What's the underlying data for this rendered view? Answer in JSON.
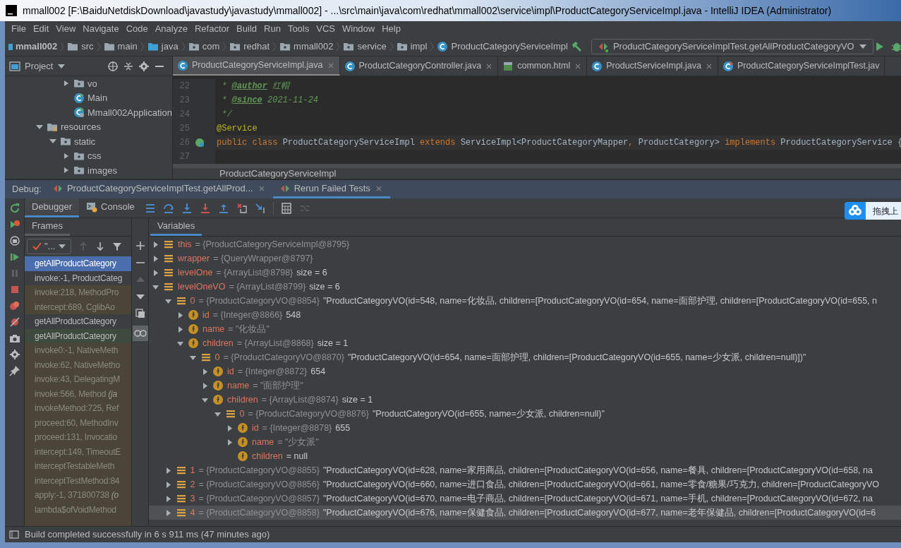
{
  "window": {
    "title": "mmall002 [F:\\BaiduNetdiskDownload\\javastudy\\javastudy\\mmall002] - ...\\src\\main\\java\\com\\redhat\\mmall002\\service\\impl\\ProductCategoryServiceImpl.java - IntelliJ IDEA (Administrator)"
  },
  "menu": [
    "File",
    "Edit",
    "View",
    "Navigate",
    "Code",
    "Analyze",
    "Refactor",
    "Build",
    "Run",
    "Tools",
    "VCS",
    "Window",
    "Help"
  ],
  "breadcrumb": [
    {
      "label": "mmall002",
      "kind": "project"
    },
    {
      "label": "src",
      "kind": "folder"
    },
    {
      "label": "main",
      "kind": "folder"
    },
    {
      "label": "java",
      "kind": "source"
    },
    {
      "label": "com",
      "kind": "package"
    },
    {
      "label": "redhat",
      "kind": "package"
    },
    {
      "label": "mmall002",
      "kind": "package"
    },
    {
      "label": "service",
      "kind": "package"
    },
    {
      "label": "impl",
      "kind": "package"
    },
    {
      "label": "ProductCategoryServiceImpl",
      "kind": "class"
    }
  ],
  "run_config": {
    "label": "ProductCategoryServiceImplTest.getAllProductCategoryVO"
  },
  "project_panel": {
    "title": "Project",
    "scrolled_items": [
      {
        "label": "vo",
        "kind": "package",
        "expanded": false
      },
      {
        "label": "Main",
        "kind": "class"
      },
      {
        "label": "Mmall002Application",
        "kind": "app_class"
      }
    ],
    "items": [
      {
        "label": "resources",
        "kind": "resources",
        "expanded": true,
        "children": [
          {
            "label": "static",
            "kind": "package",
            "expanded": true,
            "children": [
              {
                "label": "css",
                "kind": "package",
                "expanded": false
              },
              {
                "label": "images",
                "kind": "package",
                "expanded": false
              }
            ]
          }
        ]
      }
    ]
  },
  "editor_tabs": [
    {
      "label": "ProductCategoryServiceImpl.java",
      "kind": "class",
      "selected": true
    },
    {
      "label": "ProductCategoryController.java",
      "kind": "class",
      "selected": false
    },
    {
      "label": "common.html",
      "kind": "html",
      "selected": false
    },
    {
      "label": "ProductServiceImpl.java",
      "kind": "class",
      "selected": false
    },
    {
      "label": "ProductCategoryServiceImplTest.jav",
      "kind": "test",
      "selected": false
    }
  ],
  "editor": {
    "lines": [
      {
        "number": "22",
        "current": false,
        "tokens": [
          {
            "text": " * ",
            "kind": "doc"
          },
          {
            "text": "@author",
            "kind": "doctag"
          },
          {
            "text": " 红帽",
            "kind": "doc"
          }
        ]
      },
      {
        "number": "23",
        "current": false,
        "tokens": [
          {
            "text": " * ",
            "kind": "doc"
          },
          {
            "text": "@since",
            "kind": "doctag"
          },
          {
            "text": " 2021-11-24",
            "kind": "doc"
          }
        ]
      },
      {
        "number": "24",
        "current": false,
        "tokens": [
          {
            "text": " */",
            "kind": "doc"
          }
        ]
      },
      {
        "number": "25",
        "current": false,
        "tokens": [
          {
            "text": "@Service",
            "kind": "annotation"
          }
        ]
      },
      {
        "number": "26",
        "current": true,
        "tokens": [
          {
            "text": "public class ",
            "kind": "keyword"
          },
          {
            "text": "ProductCategoryServiceImpl ",
            "kind": "plain"
          },
          {
            "text": "extends ",
            "kind": "keyword"
          },
          {
            "text": "ServiceImpl<ProductCategoryMapper",
            "kind": "plain"
          },
          {
            "text": ", ",
            "kind": "keyword"
          },
          {
            "text": "ProductCategory> ",
            "kind": "plain"
          },
          {
            "text": "implements ",
            "kind": "keyword"
          },
          {
            "text": "ProductCategoryService {",
            "kind": "plain"
          }
        ]
      },
      {
        "number": "27",
        "current": false
      }
    ],
    "breadcrumb": "ProductCategoryServiceImpl"
  },
  "debug": {
    "label": "Debug:",
    "tabs": [
      {
        "label": "ProductCategoryServiceImplTest.getAllProd...",
        "selected": false
      },
      {
        "label": "Rerun Failed Tests",
        "selected": true
      }
    ],
    "subtabs": [
      {
        "label": "Debugger",
        "kind": "debugger",
        "selected": true
      },
      {
        "label": "Console",
        "kind": "console",
        "selected": false
      }
    ],
    "frames_title": "Frames",
    "thread": "\"...",
    "frames": [
      {
        "label": "getAllProductCategory",
        "kind": "project",
        "selected": true
      },
      {
        "label": "invoke:-1, ProductCateg",
        "kind": "project",
        "selected": false
      },
      {
        "label": "invoke:218, MethodPro",
        "kind": "library",
        "selected": false
      },
      {
        "label": "intercept:689, CglibAo",
        "kind": "library",
        "selected": false
      },
      {
        "label": "getAllProductCategory",
        "kind": "project",
        "selected": false
      },
      {
        "label": "getAllProductCategory",
        "kind": "test",
        "selected": false
      },
      {
        "label": "invoke0:-1, NativeMeth",
        "kind": "library",
        "selected": false
      },
      {
        "label": "invoke:62, NativeMetho",
        "kind": "library",
        "selected": false
      },
      {
        "label": "invoke:43, DelegatingM",
        "kind": "library",
        "selected": false
      },
      {
        "label": "invoke:566, Method *(ja*",
        "kind": "library",
        "selected": false
      },
      {
        "label": "invokeMethod:725, Ref",
        "kind": "library",
        "selected": false
      },
      {
        "label": "proceed:60, MethodInv",
        "kind": "library",
        "selected": false
      },
      {
        "label": "proceed:131, Invocatio",
        "kind": "library",
        "selected": false
      },
      {
        "label": "intercept:149, TimeoutE",
        "kind": "library",
        "selected": false
      },
      {
        "label": "interceptTestableMeth",
        "kind": "library",
        "selected": false
      },
      {
        "label": "interceptTestMethod:84",
        "kind": "library",
        "selected": false
      },
      {
        "label": "apply:-1, 371800738 *(o*",
        "kind": "library",
        "selected": false
      },
      {
        "label": "lambda$ofVoidMethod",
        "kind": "library",
        "selected": false
      }
    ],
    "variables_title": "Variables",
    "variables": [
      {
        "name": "this",
        "ref": "= {ProductCategoryServiceImpl@8795}",
        "kind": "object",
        "expanded": false,
        "selected": false
      },
      {
        "name": "wrapper",
        "ref": "= {QueryWrapper@8797}",
        "kind": "object",
        "expanded": false,
        "selected": false
      },
      {
        "name": "levelOne",
        "ref": "= {ArrayList@8798}",
        "value": "size = 6",
        "kind": "object",
        "expanded": false,
        "selected": false
      },
      {
        "name": "levelOneVO",
        "ref": "= {ArrayList@8799}",
        "value": "size = 6",
        "kind": "object",
        "expanded": true,
        "selected": false,
        "children": [
          {
            "name": "0",
            "ref": "= {ProductCategoryVO@8854}",
            "value": "\"ProductCategoryVO(id=548, name=化妆品, children=[ProductCategoryVO(id=654, name=面部护理, children=[ProductCategoryVO(id=655, n",
            "kind": "object",
            "expanded": true,
            "selected": false,
            "children": [
              {
                "name": "id",
                "ref": "= {Integer@8866}",
                "value": "548",
                "kind": "field",
                "expanded": false,
                "selected": false
              },
              {
                "name": "name",
                "ref": "= \"化妆品\"",
                "kind": "field",
                "expanded": false,
                "selected": false
              },
              {
                "name": "children",
                "ref": "= {ArrayList@8868}",
                "value": "size = 1",
                "kind": "field",
                "expanded": true,
                "selected": false,
                "children": [
                  {
                    "name": "0",
                    "ref": "= {ProductCategoryVO@8870}",
                    "value": "\"ProductCategoryVO(id=654, name=面部护理, children=[ProductCategoryVO(id=655, name=少女派, children=null)])\"",
                    "kind": "object",
                    "expanded": true,
                    "selected": false,
                    "children": [
                      {
                        "name": "id",
                        "ref": "= {Integer@8872}",
                        "value": "654",
                        "kind": "field",
                        "expanded": false,
                        "selected": false
                      },
                      {
                        "name": "name",
                        "ref": "= \"面部护理\"",
                        "kind": "field",
                        "expanded": false,
                        "selected": false
                      },
                      {
                        "name": "children",
                        "ref": "= {ArrayList@8874}",
                        "value": "size = 1",
                        "kind": "field",
                        "expanded": true,
                        "selected": false,
                        "children": [
                          {
                            "name": "0",
                            "ref": "= {ProductCategoryVO@8876}",
                            "value": "\"ProductCategoryVO(id=655, name=少女派, children=null)\"",
                            "kind": "object",
                            "expanded": true,
                            "selected": false,
                            "children": [
                              {
                                "name": "id",
                                "ref": "= {Integer@8878}",
                                "value": "655",
                                "kind": "field",
                                "expanded": false,
                                "selected": false
                              },
                              {
                                "name": "name",
                                "ref": "= \"少女派\"",
                                "kind": "field",
                                "expanded": false,
                                "selected": false
                              },
                              {
                                "name": "children",
                                "value": "= null",
                                "kind": "leaf_field",
                                "selected": false
                              }
                            ]
                          }
                        ]
                      }
                    ]
                  }
                ]
              }
            ]
          },
          {
            "name": "1",
            "ref": "= {ProductCategoryVO@8855}",
            "value": "\"ProductCategoryVO(id=628, name=家用商品, children=[ProductCategoryVO(id=656, name=餐具, children=[ProductCategoryVO(id=658, na",
            "kind": "object",
            "expanded": false,
            "selected": false
          },
          {
            "name": "2",
            "ref": "= {ProductCategoryVO@8856}",
            "value": "\"ProductCategoryVO(id=660, name=进口食品, children=[ProductCategoryVO(id=661, name=零食/糖果/巧克力, children=[ProductCategoryVO",
            "kind": "object",
            "expanded": false,
            "selected": false
          },
          {
            "name": "3",
            "ref": "= {ProductCategoryVO@8857}",
            "value": "\"ProductCategoryVO(id=670, name=电子商品, children=[ProductCategoryVO(id=671, name=手机, children=[ProductCategoryVO(id=672, na",
            "kind": "object",
            "expanded": false,
            "selected": false
          },
          {
            "name": "4",
            "ref": "= {ProductCategoryVO@8858}",
            "value": "\"ProductCategoryVO(id=676, name=保健食品, children=[ProductCategoryVO(id=677, name=老年保健品, children=[ProductCategoryVO(id=6",
            "kind": "object",
            "expanded": false,
            "selected": true
          }
        ]
      }
    ]
  },
  "upload_widget": {
    "label": "拖拽上"
  },
  "status_bar": {
    "message": "Build completed successfully in 6 s 911 ms (47 minutes ago)"
  }
}
